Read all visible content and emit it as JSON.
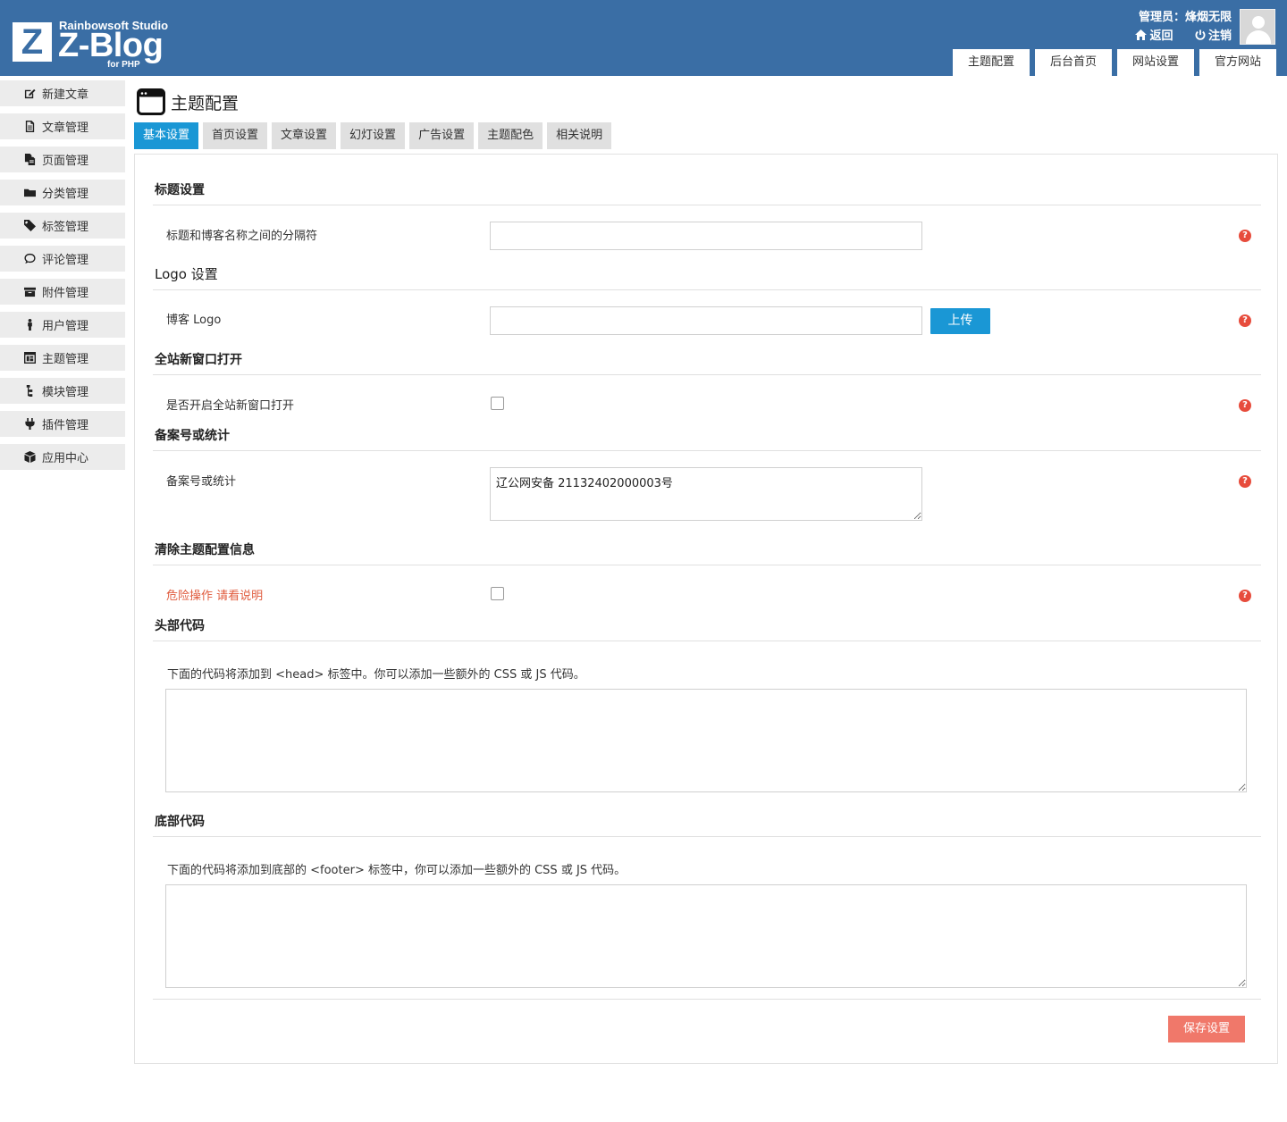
{
  "header": {
    "studio": "Rainbowsoft Studio",
    "product": "Z-Blog",
    "product_suffix": "for PHP",
    "logo_letter": "Z",
    "admin_text": "管理员：烽烟无限",
    "back_label": "返回",
    "logout_label": "注销",
    "nav": [
      "主题配置",
      "后台首页",
      "网站设置",
      "官方网站"
    ]
  },
  "sidebar": {
    "items": [
      "新建文章",
      "文章管理",
      "页面管理",
      "分类管理",
      "标签管理",
      "评论管理",
      "附件管理",
      "用户管理",
      "主题管理",
      "模块管理",
      "插件管理",
      "应用中心"
    ]
  },
  "page": {
    "title": "主题配置",
    "tabs": [
      "基本设置",
      "首页设置",
      "文章设置",
      "幻灯设置",
      "广告设置",
      "主题配色",
      "相关说明"
    ]
  },
  "sections": {
    "title_settings": "标题设置",
    "title_separator_label": "标题和博客名称之间的分隔符",
    "title_separator_value": "",
    "logo_settings": "Logo 设置",
    "blog_logo_label": "博客 Logo",
    "blog_logo_value": "",
    "upload_label": "上传",
    "new_window": "全站新窗口打开",
    "new_window_label": "是否开启全站新窗口打开",
    "icp": "备案号或统计",
    "icp_label": "备案号或统计",
    "icp_value": "辽公网安备 21132402000003号",
    "clear": "清除主题配置信息",
    "clear_label": "危险操作 请看说明",
    "head_code": "头部代码",
    "head_code_desc": "下面的代码将添加到 <head> 标签中。你可以添加一些额外的 CSS 或 JS 代码。",
    "head_code_value": "",
    "footer_code": "底部代码",
    "footer_code_desc": "下面的代码将添加到底部的 <footer> 标签中，你可以添加一些额外的 CSS 或 JS 代码。",
    "footer_code_value": "",
    "save_label": "保存设置",
    "help_glyph": "?"
  },
  "colors": {
    "header_bg": "#3a6ea5",
    "active_tab": "#1a97d5",
    "danger": "#e05c3e",
    "help": "#e74c3c",
    "save": "#f0786a"
  }
}
